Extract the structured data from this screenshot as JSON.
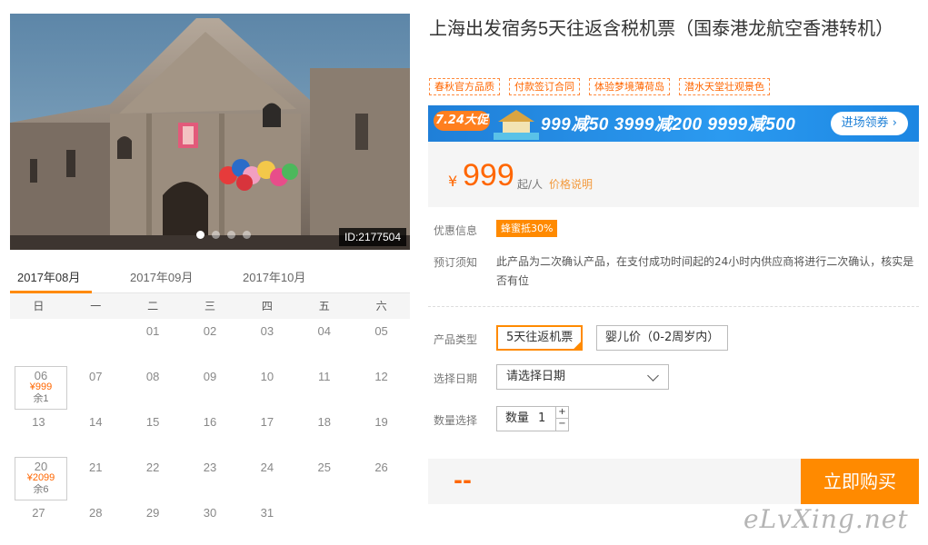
{
  "hero": {
    "photo_id": "ID:2177504",
    "slide_count": 4,
    "active_slide": 0
  },
  "calendar": {
    "tabs": [
      "2017年08月",
      "2017年09月",
      "2017年10月"
    ],
    "active_tab": 0,
    "weekdays": [
      "日",
      "一",
      "二",
      "三",
      "四",
      "五",
      "六"
    ],
    "weeks": [
      [
        null,
        null,
        {
          "day": "01"
        },
        {
          "day": "02"
        },
        {
          "day": "03"
        },
        {
          "day": "04"
        },
        {
          "day": "05"
        }
      ],
      [
        {
          "day": "06",
          "price": "¥999",
          "remain": "余1"
        },
        {
          "day": "07"
        },
        {
          "day": "08"
        },
        {
          "day": "09"
        },
        {
          "day": "10"
        },
        {
          "day": "11"
        },
        {
          "day": "12"
        }
      ],
      [
        {
          "day": "13"
        },
        {
          "day": "14"
        },
        {
          "day": "15"
        },
        {
          "day": "16"
        },
        {
          "day": "17"
        },
        {
          "day": "18"
        },
        {
          "day": "19"
        }
      ],
      [
        {
          "day": "20",
          "price": "¥2099",
          "remain": "余6"
        },
        {
          "day": "21"
        },
        {
          "day": "22"
        },
        {
          "day": "23"
        },
        {
          "day": "24"
        },
        {
          "day": "25"
        },
        {
          "day": "26"
        }
      ],
      [
        {
          "day": "27"
        },
        {
          "day": "28"
        },
        {
          "day": "29"
        },
        {
          "day": "30"
        },
        {
          "day": "31"
        },
        null,
        null
      ]
    ]
  },
  "product": {
    "title": "上海出发宿务5天往返含税机票（国泰港龙航空香港转机）",
    "tags": [
      "春秋官方品质",
      "付款签订合同",
      "体验梦境薄荷岛",
      "潜水天堂壮观景色"
    ],
    "promo": {
      "badge": "7.24大促",
      "offers": "999减50  3999减200  9999减500",
      "enter_label": "进场领券 ›"
    },
    "price": {
      "currency": "¥",
      "value": "999",
      "per": "起/人",
      "note": "价格说明"
    },
    "discount": {
      "label": "优惠信息",
      "badge": "蜂蜜抵30%"
    },
    "notice": {
      "label": "预订须知",
      "text": "此产品为二次确认产品，在支付成功时间起的24小时内供应商将进行二次确认，核实是否有位"
    },
    "type": {
      "label": "产品类型",
      "options": [
        "5天往返机票",
        "婴儿价（0-2周岁内）"
      ],
      "selected": 0
    },
    "date": {
      "label": "选择日期",
      "placeholder": "请选择日期"
    },
    "quantity": {
      "label": "数量选择",
      "field_label": "数量",
      "value": "1",
      "plus": "+",
      "minus": "−"
    },
    "total": "--",
    "buy_label": "立即购买"
  },
  "watermark": "eLvXing.net",
  "colors": {
    "accent": "#ff8a00",
    "price": "#ff6600",
    "promo_blue": "#1f7fd8"
  }
}
